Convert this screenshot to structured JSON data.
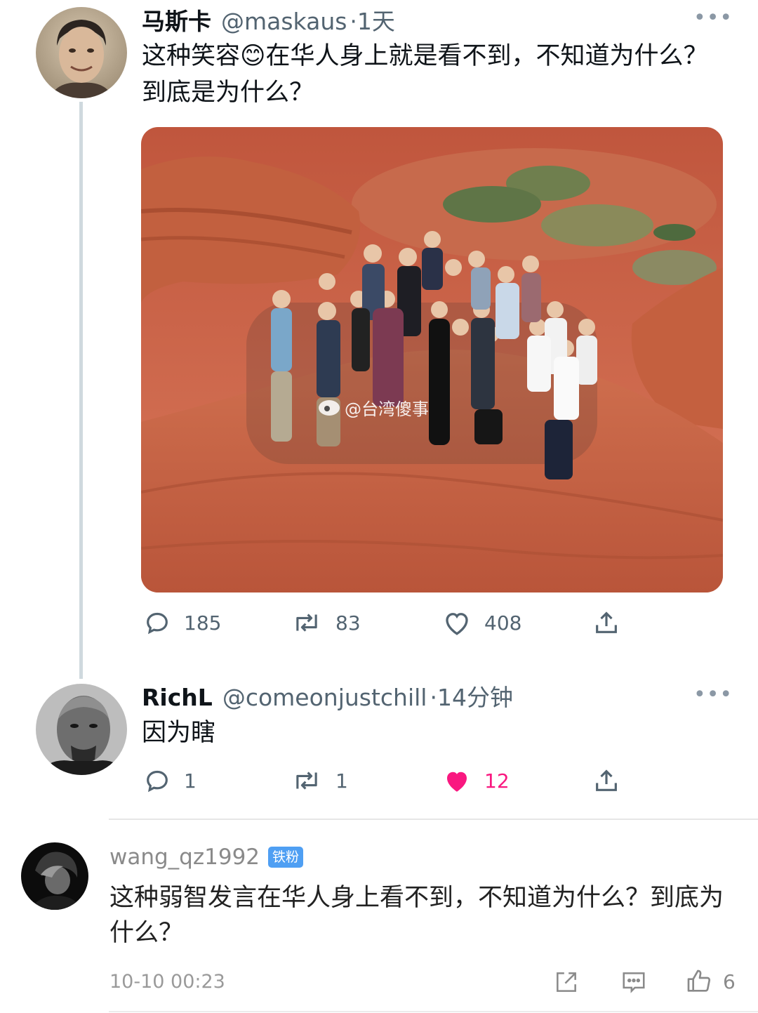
{
  "tweet": {
    "display_name": "马斯卡",
    "handle": "@maskaus",
    "time": "·1天",
    "text": "这种笑容😊在华人身上就是看不到，不知道为什么？到底是为什么？",
    "image_watermark": "@台湾傻事",
    "replies": "185",
    "retweets": "83",
    "likes": "408"
  },
  "reply": {
    "display_name": "RichL",
    "handle": "@comeonjustchill",
    "time": "·14分钟",
    "text": "因为瞎",
    "replies": "1",
    "retweets": "1",
    "likes": "12",
    "liked": true
  },
  "comment": {
    "username": "wang_qz1992",
    "badge": "铁粉",
    "text": "这种弱智发言在华人身上看不到，不知道为什么？到底为什么？",
    "time": "10-10 00:23",
    "likes": "6"
  },
  "colors": {
    "like_active": "#f91880",
    "like_count_active": "#f91880",
    "badge": "#4f9ff3",
    "secondary_text": "#536471"
  }
}
